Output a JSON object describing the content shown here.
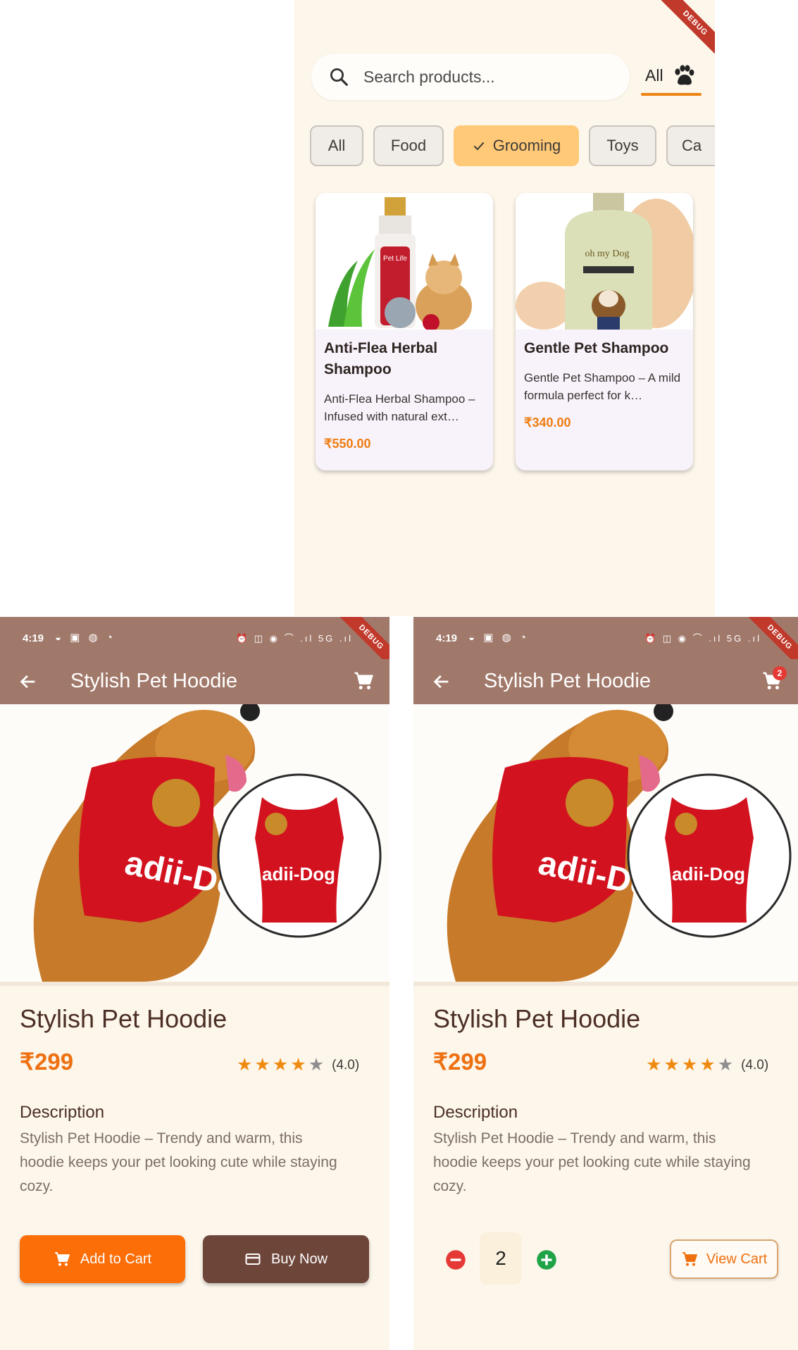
{
  "product_list": {
    "search": {
      "placeholder": "Search products..."
    },
    "filter_label": "All",
    "categories": [
      "All",
      "Food",
      "Grooming",
      "Toys",
      "Ca"
    ],
    "selected_category": "Grooming",
    "products": [
      {
        "name": "Anti-Flea Herbal Shampoo",
        "description": "Anti-Flea Herbal Shampoo – Infused with natural ext…",
        "price": "₹550.00",
        "bottle_label": "Pet Life"
      },
      {
        "name": "Gentle Pet Shampoo",
        "description": "Gentle Pet Shampoo – A mild formula perfect for k…",
        "price": "₹340.00",
        "bottle_label": "oh my Dog"
      }
    ],
    "debug_banner": "DEBUG"
  },
  "detail_left": {
    "status": {
      "time": "4:19",
      "network": "5G"
    },
    "appbar_title": "Stylish Pet Hoodie",
    "product": {
      "name": "Stylish Pet Hoodie",
      "price": "₹299",
      "rating": 4.0,
      "rating_text": "(4.0)",
      "description_heading": "Description",
      "description": "Stylish Pet Hoodie – Trendy and warm, this hoodie keeps your pet looking cute while staying cozy.",
      "brand_text": "adii-Dog"
    },
    "buttons": {
      "add_to_cart": "Add to Cart",
      "buy_now": "Buy Now"
    }
  },
  "detail_right": {
    "status": {
      "time": "4:19",
      "network": "5G"
    },
    "appbar_title": "Stylish Pet Hoodie",
    "cart_badge": "2",
    "product": {
      "name": "Stylish Pet Hoodie",
      "price": "₹299",
      "rating": 4.0,
      "rating_text": "(4.0)",
      "description_heading": "Description",
      "description": "Stylish Pet Hoodie – Trendy and warm, this hoodie keeps your pet looking cute while staying cozy.",
      "brand_text": "adii-Dog"
    },
    "quantity": "2",
    "buttons": {
      "view_cart": "View Cart"
    }
  },
  "colors": {
    "accent_orange": "#ee7010",
    "appbar_brown": "#a1796b",
    "buy_now_brown": "#6d4539",
    "chip_selected": "#ffc978",
    "background_cream": "#fdf6eb"
  },
  "icons": [
    "search-icon",
    "paw-icon",
    "check-icon",
    "back-arrow-icon",
    "cart-icon",
    "card-icon",
    "minus-circle-icon",
    "plus-circle-icon",
    "star-icon"
  ]
}
